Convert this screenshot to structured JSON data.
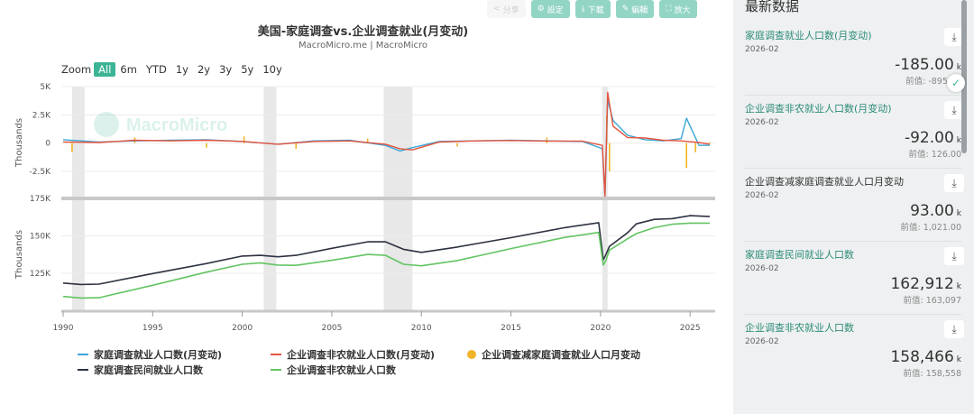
{
  "toolbar": {
    "share_label": "分享",
    "settings_label": "設定",
    "download_label": "下載",
    "edit_label": "編輯",
    "expand_label": "放大"
  },
  "zoom": {
    "label": "Zoom",
    "options": [
      "All",
      "6m",
      "YTD",
      "1y",
      "2y",
      "3y",
      "5y",
      "10y"
    ],
    "active": "All"
  },
  "watermark": "MacroMicro",
  "chart_data": {
    "type": "line",
    "title": "美国-家庭调查vs.企业调查就业(月变动)",
    "subtitle": "MacroMicro.me | MacroMicro",
    "x_ticks": [
      "1990",
      "1995",
      "2000",
      "2005",
      "2010",
      "2015",
      "2020",
      "2025"
    ],
    "xlim": [
      1989.9,
      2026.4
    ],
    "recessions": [
      [
        1990.5,
        1991.2
      ],
      [
        2001.2,
        2001.9
      ],
      [
        2007.9,
        2009.5
      ],
      [
        2020.1,
        2020.4
      ]
    ],
    "panels": [
      {
        "ylabel": "Thousands",
        "y_ticks": [
          "5K",
          "2.5K",
          "0",
          "-2.5K"
        ],
        "ylim": [
          -5000,
          5000
        ],
        "series": [
          {
            "name": "家庭调查就业人口数(月变动)",
            "color": "#3aa7d8",
            "style": "line",
            "x": [
              1990,
              1992,
              1994,
              1996,
              1998,
              2000,
              2002,
              2004,
              2006,
              2008,
              2008.8,
              2009.5,
              2011,
              2013,
              2015,
              2017,
              2019,
              2020.1,
              2020.25,
              2020.4,
              2020.7,
              2021.5,
              2022.5,
              2023.5,
              2024.5,
              2024.8,
              2025.5,
              2026.1
            ],
            "y": [
              300,
              100,
              200,
              250,
              300,
              150,
              -100,
              200,
              250,
              -200,
              -700,
              -400,
              150,
              200,
              250,
              200,
              150,
              -500,
              -22000,
              3800,
              2000,
              700,
              300,
              200,
              400,
              2200,
              -200,
              -185
            ]
          },
          {
            "name": "企业调查非农就业人口数(月变动)",
            "color": "#e5533d",
            "style": "line",
            "x": [
              1990,
              1992,
              1994,
              1996,
              1998,
              2000,
              2002,
              2004,
              2006,
              2008,
              2008.8,
              2009.5,
              2011,
              2013,
              2015,
              2017,
              2019,
              2020.1,
              2020.25,
              2020.4,
              2020.7,
              2021.5,
              2022.5,
              2023.5,
              2024.5,
              2025.5,
              2026.1
            ],
            "y": [
              100,
              50,
              250,
              200,
              250,
              150,
              -100,
              150,
              200,
              -100,
              -500,
              -600,
              100,
              200,
              230,
              180,
              170,
              -200,
              -20500,
              4500,
              1500,
              500,
              450,
              250,
              200,
              50,
              -92
            ]
          },
          {
            "name": "企业调查减家庭调查就业人口月变动",
            "color": "#f0b429",
            "style": "bar",
            "x": [
              1990.5,
              1994,
              1998,
              2000.1,
              2003,
              2007,
              2012,
              2017,
              2020.35,
              2020.5,
              2024.8,
              2025.3,
              2026.1
            ],
            "y": [
              -800,
              500,
              -400,
              600,
              -500,
              400,
              -300,
              500,
              2500,
              -2500,
              -2200,
              -800,
              93
            ]
          }
        ]
      },
      {
        "ylabel": "Thousands",
        "y_ticks": [
          "175K",
          "150K",
          "125K"
        ],
        "ylim": [
          100000,
          175000
        ],
        "series": [
          {
            "name": "家庭调查民间就业人口数",
            "color": "#2d3142",
            "style": "line",
            "x": [
              1990,
              1991,
              1992,
              1995,
              1998,
              2000,
              2001,
              2002,
              2003,
              2005,
              2007,
              2008,
              2009,
              2010,
              2012,
              2015,
              2018,
              2019.9,
              2020.15,
              2020.3,
              2020.5,
              2021.5,
              2022,
              2023,
              2024,
              2025,
              2026.1
            ],
            "y": [
              118500,
              117500,
              117800,
              124800,
              131500,
              136500,
              137000,
              136000,
              137000,
              141700,
              146000,
              146000,
              141000,
              139000,
              142500,
              148800,
              155500,
              158800,
              134000,
              137500,
              143000,
              152000,
              158000,
              161000,
              161500,
              163500,
              162912
            ]
          },
          {
            "name": "企业调查非农就业人口数",
            "color": "#62c462",
            "style": "line",
            "x": [
              1990,
              1991,
              1992,
              1995,
              1998,
              2000,
              2001,
              2002,
              2003,
              2005,
              2007,
              2008,
              2009,
              2010,
              2012,
              2015,
              2018,
              2019.9,
              2020.15,
              2020.3,
              2020.5,
              2021.5,
              2022,
              2023,
              2024,
              2025,
              2026.1
            ],
            "y": [
              109500,
              108500,
              108700,
              117000,
              125800,
              131000,
              132000,
              130500,
              130300,
              133700,
              137600,
              137000,
              131000,
              130000,
              133500,
              141500,
              149000,
              152300,
              130500,
              133500,
              140500,
              148000,
              151500,
              155500,
              157800,
              158500,
              158466
            ]
          }
        ]
      }
    ]
  },
  "side": {
    "title": "最新数据",
    "cards": [
      {
        "name": "家庭调查就业人口数(月变动)",
        "date": "2026-02",
        "value": "-185.00",
        "unit": "k",
        "prev": "前值: -895.00"
      },
      {
        "name": "企业调查非农就业人口数(月变动)",
        "date": "2026-02",
        "value": "-92.00",
        "unit": "k",
        "prev": "前值: 126.00"
      },
      {
        "name": "企业调查减家庭调查就业人口月变动",
        "date": "2026-02",
        "value": "93.00",
        "unit": "k",
        "prev": "前值: 1,021.00"
      },
      {
        "name": "家庭调查民间就业人口数",
        "date": "2026-02",
        "value": "162,912",
        "unit": "k",
        "prev": "前值: 163,097"
      },
      {
        "name": "企业调查非农就业人口数",
        "date": "2026-02",
        "value": "158,466",
        "unit": "k",
        "prev": "前值: 158,558"
      }
    ]
  },
  "colors": {
    "accent": "#3cb496",
    "recession": "#e8e8e8"
  }
}
